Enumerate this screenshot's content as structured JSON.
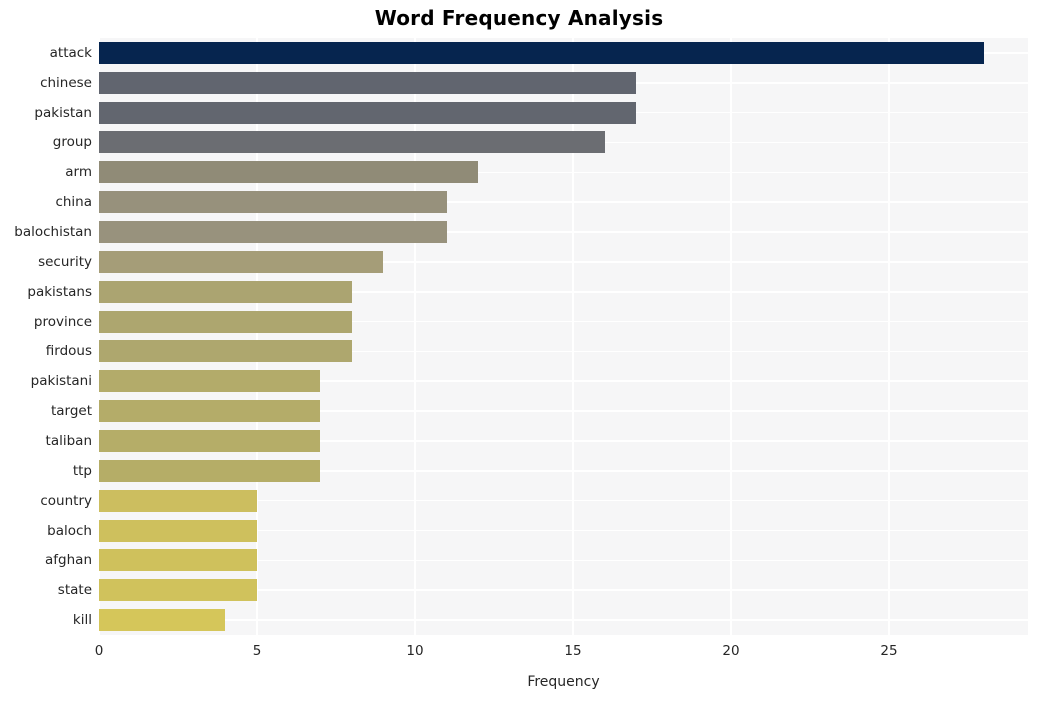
{
  "chart_data": {
    "type": "bar",
    "orientation": "horizontal",
    "title": "Word Frequency Analysis",
    "xlabel": "Frequency",
    "ylabel": "",
    "categories": [
      "attack",
      "chinese",
      "pakistan",
      "group",
      "arm",
      "china",
      "balochistan",
      "security",
      "pakistans",
      "province",
      "firdous",
      "pakistani",
      "target",
      "taliban",
      "ttp",
      "country",
      "baloch",
      "afghan",
      "state",
      "kill"
    ],
    "values": [
      28,
      17,
      17,
      16,
      12,
      11,
      11,
      9,
      8,
      8,
      8,
      7,
      7,
      7,
      7,
      5,
      5,
      5,
      5,
      4
    ],
    "bar_colors": [
      "#06254f",
      "#61656f",
      "#62666f",
      "#6b6d72",
      "#908b77",
      "#97917c",
      "#98927d",
      "#a59d78",
      "#aba471",
      "#ada66f",
      "#aea76e",
      "#b3ab6a",
      "#b4ac69",
      "#b5ad68",
      "#b5ad67",
      "#ccbe5f",
      "#cec05d",
      "#cfc15c",
      "#d0c25c",
      "#d5c65a"
    ],
    "xticks": [
      0,
      5,
      10,
      15,
      20,
      25
    ],
    "xtick_labels": [
      "0",
      "5",
      "10",
      "15",
      "20",
      "25"
    ],
    "xlim": [
      0,
      29.4
    ],
    "grid": true,
    "grid_color": "#ffffff",
    "plot_background": "#f6f6f7",
    "figure_background": "#ffffff",
    "legend": null
  }
}
